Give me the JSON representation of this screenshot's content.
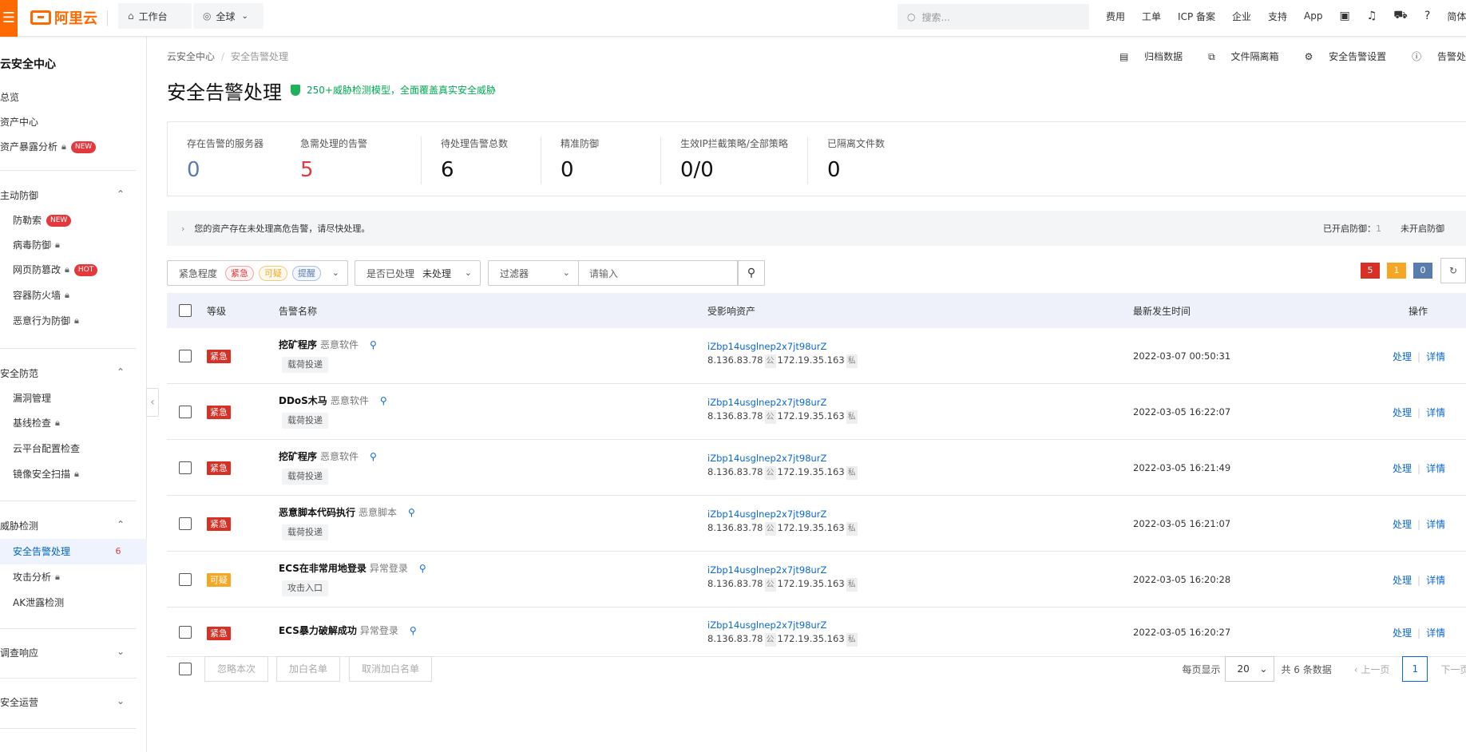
{
  "topbar": {
    "logo": "阿里云",
    "workbench": "工作台",
    "region": "全球",
    "search_placeholder": "搜索...",
    "links": [
      "费用",
      "工单",
      "ICP 备案",
      "企业",
      "支持",
      "App"
    ],
    "lang": "简体"
  },
  "sidebar": {
    "title": "云安全中心",
    "top_items": [
      "总览",
      "资产中心",
      "资产暴露分析"
    ],
    "new_badge": "NEW",
    "hot_badge": "HOT",
    "groups": [
      {
        "label": "主动防御",
        "items": [
          "防勒索",
          "病毒防御",
          "网页防篡改",
          "容器防火墙",
          "恶意行为防御"
        ]
      },
      {
        "label": "安全防范",
        "items": [
          "漏洞管理",
          "基线检查",
          "云平台配置检查",
          "镜像安全扫描"
        ]
      },
      {
        "label": "威胁检测",
        "items": [
          "安全告警处理",
          "攻击分析",
          "AK泄露检测"
        ]
      },
      {
        "label": "调查响应"
      },
      {
        "label": "安全运营"
      }
    ],
    "active_count": "6"
  },
  "page": {
    "breadcrumb": [
      "云安全中心",
      "安全告警处理"
    ],
    "top_links": [
      "归档数据",
      "文件隔离箱",
      "安全告警设置",
      "告警处"
    ],
    "title": "安全告警处理",
    "badge_text": "250+威胁检测模型，全面覆盖真实安全威胁"
  },
  "stats": [
    {
      "label": "存在告警的服务器",
      "value": "0"
    },
    {
      "label": "急需处理的告警",
      "value": "5"
    },
    {
      "label": "待处理告警总数",
      "value": "6"
    },
    {
      "label": "精准防御",
      "value": "0"
    },
    {
      "label": "生效IP拦截策略/全部策略",
      "value": "0/0"
    },
    {
      "label": "已隔离文件数",
      "value": "0"
    }
  ],
  "notice": {
    "text": "您的资产存在未处理高危告警，请尽快处理。",
    "enabled_label": "已开启防御：",
    "enabled_value": "1",
    "disabled_label": "未开启防御"
  },
  "filters": {
    "severity_label": "紧急程度",
    "severity_tags": [
      "紧急",
      "可疑",
      "提醒"
    ],
    "handled_label": "是否已处理",
    "handled_value": "未处理",
    "filter_label": "过滤器",
    "input_placeholder": "请输入",
    "counts": [
      "5",
      "1",
      "0"
    ]
  },
  "table": {
    "headers": [
      "等级",
      "告警名称",
      "受影响资产",
      "最新发生时间",
      "操作"
    ],
    "rows": [
      {
        "level": "紧急",
        "name": "挖矿程序",
        "cat": "恶意软件",
        "tag": "载荷投递",
        "asset": "iZbp14usglnep2x7jt98urZ",
        "pub": "8.136.83.78",
        "pub_tag": "公",
        "priv": "172.19.35.163",
        "priv_tag": "私",
        "time": "2022-03-07 00:50:31",
        "op1": "处理",
        "op2": "详情"
      },
      {
        "level": "紧急",
        "name": "DDoS木马",
        "cat": "恶意软件",
        "tag": "载荷投递",
        "asset": "iZbp14usglnep2x7jt98urZ",
        "pub": "8.136.83.78",
        "pub_tag": "公",
        "priv": "172.19.35.163",
        "priv_tag": "私",
        "time": "2022-03-05 16:22:07",
        "op1": "处理",
        "op2": "详情"
      },
      {
        "level": "紧急",
        "name": "挖矿程序",
        "cat": "恶意软件",
        "tag": "载荷投递",
        "asset": "iZbp14usglnep2x7jt98urZ",
        "pub": "8.136.83.78",
        "pub_tag": "公",
        "priv": "172.19.35.163",
        "priv_tag": "私",
        "time": "2022-03-05 16:21:49",
        "op1": "处理",
        "op2": "详情"
      },
      {
        "level": "紧急",
        "name": "恶意脚本代码执行",
        "cat": "恶意脚本",
        "tag": "载荷投递",
        "asset": "iZbp14usglnep2x7jt98urZ",
        "pub": "8.136.83.78",
        "pub_tag": "公",
        "priv": "172.19.35.163",
        "priv_tag": "私",
        "time": "2022-03-05 16:21:07",
        "op1": "处理",
        "op2": "详情"
      },
      {
        "level": "可疑",
        "name": "ECS在非常用地登录",
        "cat": "异常登录",
        "tag": "攻击入口",
        "asset": "iZbp14usglnep2x7jt98urZ",
        "pub": "8.136.83.78",
        "pub_tag": "公",
        "priv": "172.19.35.163",
        "priv_tag": "私",
        "time": "2022-03-05 16:20:28",
        "op1": "处理",
        "op2": "详情"
      },
      {
        "level": "紧急",
        "name": "ECS暴力破解成功",
        "cat": "异常登录",
        "tag": "",
        "asset": "iZbp14usglnep2x7jt98urZ",
        "pub": "8.136.83.78",
        "pub_tag": "公",
        "priv": "172.19.35.163",
        "priv_tag": "私",
        "time": "2022-03-05 16:20:27",
        "op1": "处理",
        "op2": "详情"
      }
    ]
  },
  "footer": {
    "buttons": [
      "忽略本次",
      "加白名单",
      "取消加白名单"
    ],
    "per_page_label": "每页显示",
    "per_page": "20",
    "total": "共 6 条数据",
    "prev": "上一页",
    "page": "1",
    "next": "下一页"
  },
  "colors": {
    "accent": "#ff6a00",
    "link": "#0a68d3",
    "danger": "#d93026",
    "warn": "#f5a623",
    "muted": "#5a7bad"
  }
}
